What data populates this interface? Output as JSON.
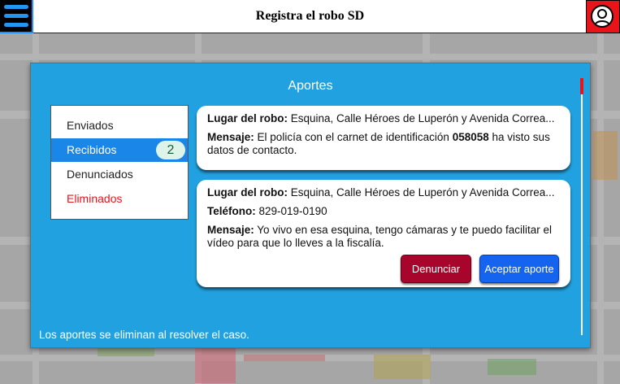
{
  "header": {
    "title": "Registra el robo SD",
    "menu_icon": "hamburger-menu-icon",
    "user_icon": "user-avatar-icon"
  },
  "modal": {
    "title": "Aportes",
    "footnote": "Los aportes se eliminan al resolver el caso."
  },
  "sidebar": {
    "items": [
      {
        "label": "Enviados"
      },
      {
        "label": "Recibidos",
        "badge": "2"
      },
      {
        "label": "Denunciados"
      },
      {
        "label": "Eliminados"
      }
    ]
  },
  "cards": [
    {
      "place_label": "Lugar del robo:",
      "place_value": "Esquina, Calle Héroes de Luperón y Avenida Correa...",
      "message_label": "Mensaje:",
      "message_pre": "El policía con el carnet de identificación",
      "message_id": "058058",
      "message_post": "ha visto sus datos de contacto."
    },
    {
      "place_label": "Lugar del robo:",
      "place_value": "Esquina, Calle Héroes de Luperón y Avenida Correa...",
      "phone_label": "Teléfono:",
      "phone_value": "829-019-0190",
      "message_label": "Mensaje:",
      "message_value": "Yo vivo en esa esquina, tengo cámaras y te puedo facilitar el vídeo para que lo lleves a la fiscalía.",
      "report_button": "Denunciar",
      "accept_button": "Aceptar aporte"
    }
  ],
  "colors": {
    "accent": "#21a1df",
    "active_item": "#1a87e8",
    "danger": "#a8052c",
    "primary_button": "#1564ef",
    "alert": "#e8141a"
  }
}
